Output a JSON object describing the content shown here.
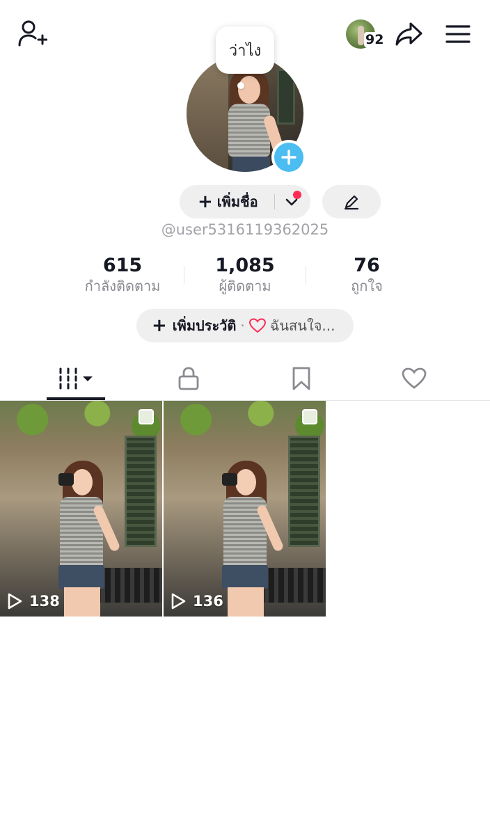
{
  "top_bar": {
    "following_avatar_count": "92"
  },
  "profile": {
    "speech_bubble": "ว่าไง",
    "add_name_label": "เพิ่มชื่อ",
    "handle": "@user5316119362025"
  },
  "stats": [
    {
      "value": "615",
      "label": "กำลังติดตาม"
    },
    {
      "value": "1,085",
      "label": "ผู้ติดตาม"
    },
    {
      "value": "76",
      "label": "ถูกใจ"
    }
  ],
  "bio": {
    "add_bio_label": "เพิ่มประวัติ",
    "separator": "·",
    "interest_label": "ฉันสนใจ..."
  },
  "tabs": [
    {
      "icon": "grid-icon",
      "active": true
    },
    {
      "icon": "lock-icon",
      "active": false
    },
    {
      "icon": "bookmark-icon",
      "active": false
    },
    {
      "icon": "heart-icon",
      "active": false
    }
  ],
  "videos": [
    {
      "views": "138"
    },
    {
      "views": "136"
    }
  ],
  "colors": {
    "accent_blue": "#4cbdf0",
    "notification_red": "#fe2c55",
    "pill_bg": "#efeff0",
    "text_primary": "#161823",
    "text_secondary": "#8a8b91"
  }
}
